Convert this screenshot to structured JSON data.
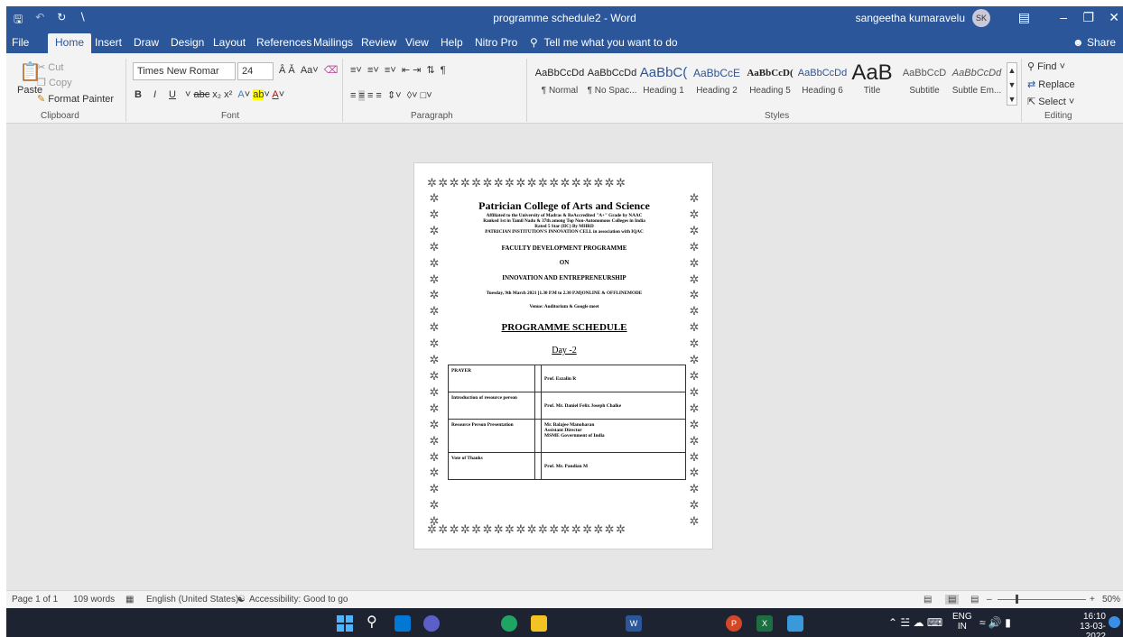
{
  "window": {
    "title": "programme schedule2 - Word",
    "user": "sangeetha kumaravelu",
    "avatar": "SK"
  },
  "tabs": [
    "File",
    "Home",
    "Insert",
    "Draw",
    "Design",
    "Layout",
    "References",
    "Mailings",
    "Review",
    "View",
    "Help",
    "Nitro Pro"
  ],
  "active_tab": "Home",
  "tell_me": "Tell me what you want to do",
  "share": "Share",
  "clipboard": {
    "cut": "Cut",
    "copy": "Copy",
    "paste": "Paste",
    "format_painter": "Format Painter",
    "label": "Clipboard"
  },
  "font": {
    "name": "Times New Romar",
    "size": "24",
    "label": "Font"
  },
  "paragraph": {
    "label": "Paragraph"
  },
  "styles": {
    "label": "Styles",
    "items": [
      {
        "sample": "AaBbCcDd",
        "name": "¶ Normal"
      },
      {
        "sample": "AaBbCcDd",
        "name": "¶ No Spac..."
      },
      {
        "sample": "AaBbC(",
        "name": "Heading 1"
      },
      {
        "sample": "AaBbCcE",
        "name": "Heading 2"
      },
      {
        "sample": "AaBbCcD(",
        "name": "Heading 5"
      },
      {
        "sample": "AaBbCcDd",
        "name": "Heading 6"
      },
      {
        "sample": "AaB",
        "name": "Title"
      },
      {
        "sample": "AaBbCcD",
        "name": "Subtitle"
      },
      {
        "sample": "AaBbCcDd",
        "name": "Subtle Em..."
      }
    ]
  },
  "editing": {
    "find": "Find",
    "replace": "Replace",
    "select": "Select",
    "label": "Editing"
  },
  "document": {
    "college": "Patrician College of Arts and Science",
    "line1": "Affiliated to the University of Madras & ReAccredited \"A+\" Grade by NAAC",
    "line2": "Ranked 1st in Tamil Nadu & 37th among Top Non-Autonomous Colleges in India",
    "line3": "Rated 5 Star (IIC) By MHRD",
    "line4": "PATRICIAN INSTITUTION'S INNOVATION CELL in association with IQAC",
    "fdp": "FACULTY DEVELOPMENT PROGRAMME",
    "on": "ON",
    "topic": "INNOVATION AND ENTREPRENEURSHIP",
    "date": "Tuesday, 9th March 2021 [1.30 P.M to 2.30 P.M]ONLINE & OFFLINEMODE",
    "venue": "Venue: Auditorium & Google meet",
    "heading": "PROGRAMME SCHEDULE",
    "day": "Day -2",
    "schedule": [
      {
        "item": "PRAYER",
        "person": "Prof. Ezzalin R"
      },
      {
        "item": "Introduction of resource person",
        "person": "Prof. Mr. Daniel Felix Joseph Chalke"
      },
      {
        "item": "Resource Person Presentation",
        "person": "Mr. Balajee Manoharan\nAssistant Director\nMSME Government of India"
      },
      {
        "item": "Vote of Thanks",
        "person": "Prof. Mr. Pandian M"
      }
    ]
  },
  "status": {
    "page": "Page 1 of 1",
    "words": "109 words",
    "language": "English (United States)",
    "accessibility": "Accessibility: Good to go",
    "zoom": "50%"
  },
  "taskbar": {
    "lang_top": "ENG",
    "lang_bottom": "IN",
    "time": "16:10",
    "date": "13-03-2022"
  }
}
